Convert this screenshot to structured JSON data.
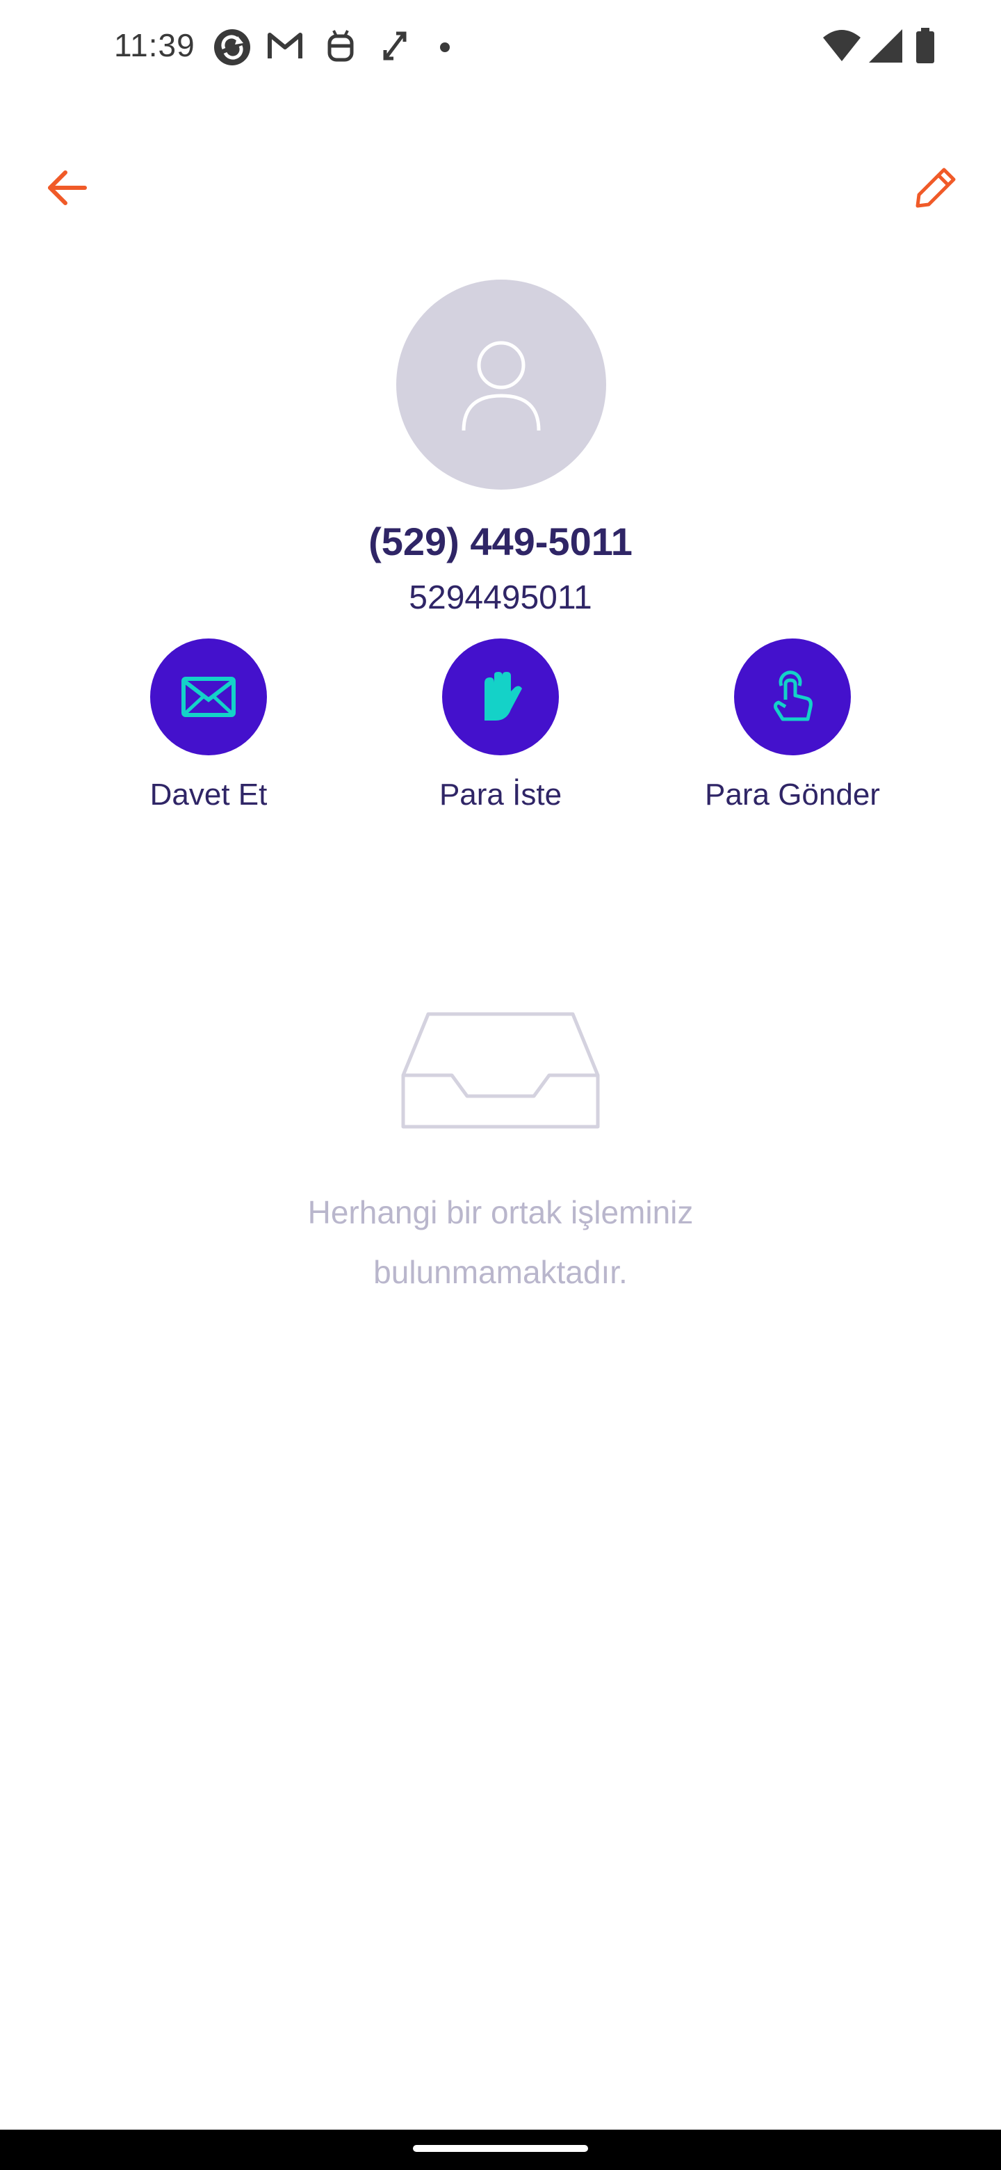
{
  "status_bar": {
    "time": "11:39",
    "left_icons": [
      "sync-icon",
      "gmail-icon",
      "android-debug-icon",
      "expand-icon",
      "dot-icon"
    ],
    "right_icons": [
      "wifi-icon",
      "signal-icon",
      "battery-icon"
    ]
  },
  "app_bar": {
    "back_icon": "arrow-left-icon",
    "edit_icon": "pencil-icon",
    "accent_color": "#f05a28"
  },
  "contact": {
    "name": "(529) 449-5011",
    "number": "5294495011",
    "avatar_icon": "person-icon"
  },
  "actions": [
    {
      "label": "Davet Et",
      "icon": "envelope-icon"
    },
    {
      "label": "Para İste",
      "icon": "hand-icon"
    },
    {
      "label": "Para Gönder",
      "icon": "touch-icon"
    }
  ],
  "empty_state": {
    "icon": "inbox-icon",
    "text": "Herhangi bir ortak işleminiz bulunmamaktadır."
  },
  "colors": {
    "primary": "#4411cc",
    "icon_accent": "#14d2c8",
    "text_dark": "#2f2566",
    "text_muted": "#b9b6cc",
    "avatar_bg": "#d4d2df"
  }
}
